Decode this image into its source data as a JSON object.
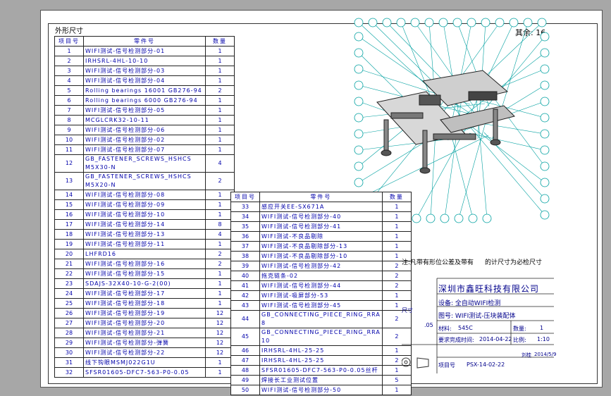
{
  "sheet": {
    "corner_label": "外形尺寸",
    "qty_note": "其余: 16"
  },
  "bom_left": {
    "headers": [
      "项目号",
      "零件号",
      "数量"
    ],
    "rows": [
      [
        "1",
        "WIFI测试-信号检测部分-01",
        "1"
      ],
      [
        "2",
        "IRHSRL-4HL-10-10",
        "1"
      ],
      [
        "3",
        "WIFI测试-信号检测部分-03",
        "1"
      ],
      [
        "4",
        "WIFI测试-信号检测部分-04",
        "1"
      ],
      [
        "5",
        "Rolling bearings 16001 GB276-94",
        "2"
      ],
      [
        "6",
        "Rolling bearings 6000 GB276-94",
        "1"
      ],
      [
        "7",
        "WIFI测试-信号检测部分-05",
        "1"
      ],
      [
        "8",
        "MCGLCRK32-10-11",
        "1"
      ],
      [
        "9",
        "WIFI测试-信号检测部分-06",
        "1"
      ],
      [
        "10",
        "WIFI测试-信号检测部分-02",
        "1"
      ],
      [
        "11",
        "WIFI测试-信号检测部分-07",
        "1"
      ],
      [
        "12",
        "GB_FASTENER_SCREWS_HSHCS M5X30-N",
        "4"
      ],
      [
        "13",
        "GB_FASTENER_SCREWS_HSHCS M5X20-N",
        "2"
      ],
      [
        "14",
        "WIFI测试-信号检测部分-08",
        "1"
      ],
      [
        "15",
        "WIFI测试-信号检测部分-09",
        "1"
      ],
      [
        "16",
        "WIFI测试-信号检测部分-10",
        "1"
      ],
      [
        "17",
        "WIFI测试-信号检测部分-14",
        "8"
      ],
      [
        "18",
        "WIFI测试-信号检测部分-13",
        "4"
      ],
      [
        "19",
        "WIFI测试-信号检测部分-11",
        "1"
      ],
      [
        "20",
        "LHFRD16",
        "2"
      ],
      [
        "21",
        "WIFI测试-信号检测部分-16",
        "2"
      ],
      [
        "22",
        "WIFI测试-信号检测部分-15",
        "1"
      ],
      [
        "23",
        "SDAJS-32X40-10-G-2(00)",
        "1"
      ],
      [
        "24",
        "WIFI测试-信号检测部分-17",
        "1"
      ],
      [
        "25",
        "WIFI测试-信号检测部分-18",
        "1"
      ],
      [
        "26",
        "WIFI测试-信号检测部分-19",
        "12"
      ],
      [
        "27",
        "WIFI测试-信号检测部分-20",
        "12"
      ],
      [
        "28",
        "WIFI测试-信号检测部分-21",
        "12"
      ],
      [
        "29",
        "WIFI测试-信号检测部分-弹簧",
        "12"
      ],
      [
        "30",
        "WIFI测试-信号检测部分-22",
        "12"
      ],
      [
        "31",
        "线下钩眼MSMJ022G1U",
        "1"
      ],
      [
        "32",
        "SFSR01605-DFC7-563-P0-0.05",
        "1"
      ]
    ]
  },
  "bom_right": {
    "headers": [
      "项目号",
      "零件号",
      "数量"
    ],
    "rows": [
      [
        "33",
        "感应开关EE-SX671A",
        "1"
      ],
      [
        "34",
        "WIFI测试-信号检测部分-40",
        "1"
      ],
      [
        "35",
        "WIFI测试-信号检测部分-41",
        "1"
      ],
      [
        "36",
        "WIFI测试-不良品剔除",
        "1"
      ],
      [
        "37",
        "WIFI测试-不良品剔除部分-13",
        "1"
      ],
      [
        "38",
        "WIFI测试-不良品剔除部分-10",
        "1"
      ],
      [
        "39",
        "WIFI测试-信号检测部分-42",
        "2"
      ],
      [
        "40",
        "拖克链条-02",
        "2"
      ],
      [
        "41",
        "WIFI测试-信号检测部分-44",
        "2"
      ],
      [
        "42",
        "WIFI测试-吸屏部分-53",
        "1"
      ],
      [
        "43",
        "WIFI测试-信号检测部分-45",
        "1"
      ],
      [
        "44",
        "GB_CONNECTING_PIECE_RING_RRA 8",
        "2"
      ],
      [
        "45",
        "GB_CONNECTING_PIECE_RING_RRA 10",
        "2"
      ],
      [
        "46",
        "IRHSRL-4HL-25-25",
        "1"
      ],
      [
        "47",
        "IRHSRL-4HL-25-25",
        "2"
      ],
      [
        "48",
        "SFSR01605-DFC7-563-P0-0.05丝杆",
        "1"
      ],
      [
        "49",
        "焊接长工业测试位置",
        "5"
      ],
      [
        "50",
        "WIFI测试-信号检测部分-50",
        "1"
      ]
    ]
  },
  "title_block": {
    "note1": "注:凡带有形位公差及带有",
    "note2": "的计尺寸为必检尺寸",
    "company": "深圳市鑫旺科技有限公司",
    "device": "设备: 全自动WIFI检测",
    "drawing_no": "图号: WIFI测试-压块装配体",
    "material_label": "材料:",
    "material": "545C",
    "qty_label": "数量:",
    "qty": "1",
    "date_label": "要求完成时间:",
    "date": "2014-04-22",
    "scale_label": "比例:",
    "scale": "1:10",
    "project_label": "项目号",
    "project": "PSX-14-02-22",
    "dim1": "尺寸",
    "dim2": ".05",
    "designer_date": "2014/5/9",
    "designer": "刘桂"
  }
}
